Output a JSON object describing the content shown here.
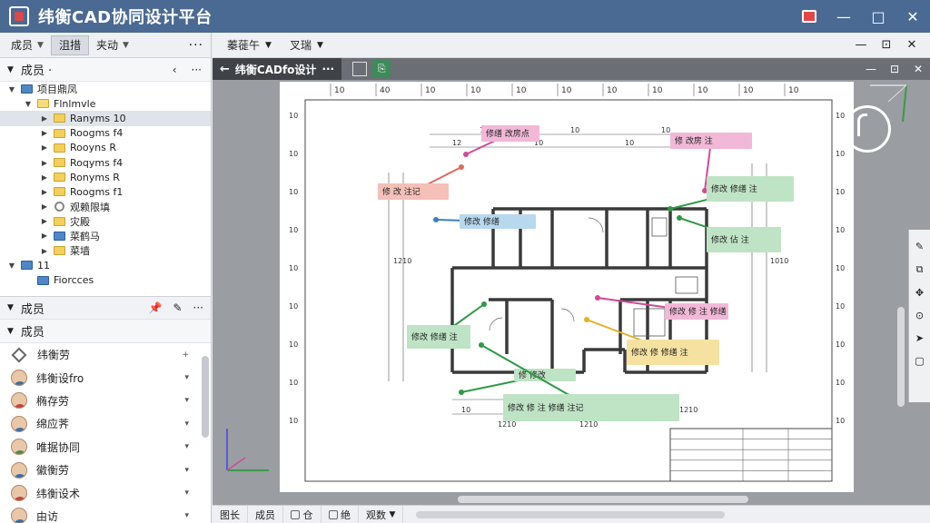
{
  "app": {
    "title": "纬衡CAD协同设计平台"
  },
  "window": {
    "minimize": "—",
    "maximize": "□",
    "close": "✕"
  },
  "left_toolbar": {
    "tabs": [
      {
        "label": "成员",
        "has_chevron": true
      },
      {
        "label": "沮措",
        "active": true
      },
      {
        "label": "夹动",
        "has_chevron": true
      }
    ],
    "more": "···"
  },
  "tree_header": {
    "label": "成员 ·",
    "collapse": "‹",
    "more": "···"
  },
  "tree": [
    {
      "label": "项目鼎凤",
      "level": 0,
      "expand": "▼",
      "icon": "blue"
    },
    {
      "label": "Flnlmvle",
      "level": 1,
      "expand": "▼",
      "icon": "open"
    },
    {
      "label": "Ranyms 10",
      "level": 2,
      "expand": "▶",
      "icon": "yellow",
      "selected": true
    },
    {
      "label": "Roogms f4",
      "level": 2,
      "expand": "▶",
      "icon": "yellow"
    },
    {
      "label": "Rooyns R",
      "level": 2,
      "expand": "▶",
      "icon": "yellow"
    },
    {
      "label": "Roqyms f4",
      "level": 2,
      "expand": "▶",
      "icon": "yellow"
    },
    {
      "label": "Ronyms R",
      "level": 2,
      "expand": "▶",
      "icon": "yellow"
    },
    {
      "label": "Roogms f1",
      "level": 2,
      "expand": "▶",
      "icon": "yellow"
    },
    {
      "label": "观赖限填",
      "level": 2,
      "expand": "▶",
      "icon": "gear"
    },
    {
      "label": "灾殿",
      "level": 2,
      "expand": "▶",
      "icon": "yellow"
    },
    {
      "label": "菜鹤马",
      "level": 2,
      "expand": "▶",
      "icon": "blue"
    },
    {
      "label": "菜墙",
      "level": 2,
      "expand": "▶",
      "icon": "yellow"
    },
    {
      "label": "11",
      "level": 0,
      "expand": "▼",
      "icon": "blue"
    },
    {
      "label": "Fiorcces",
      "level": 1,
      "expand": "",
      "icon": "blue"
    }
  ],
  "members_toolbar": {
    "label": "成员",
    "pin": "📌",
    "edit": "✎",
    "more": "···"
  },
  "members_header": {
    "label": "成员"
  },
  "members": [
    {
      "name": "纬衡劳",
      "type": "diamond",
      "action": "+"
    },
    {
      "name": "纬衡设fro",
      "type": "m",
      "action": "▾"
    },
    {
      "name": "椭存劳",
      "type": "f",
      "action": "▾"
    },
    {
      "name": "绵应荠",
      "type": "m",
      "action": "▾"
    },
    {
      "name": "唯据协同",
      "type": "g",
      "action": "▾"
    },
    {
      "name": "徽衡劳",
      "type": "m",
      "action": "▾"
    },
    {
      "name": "纬衡设术",
      "type": "f",
      "action": "▾"
    },
    {
      "name": "由访",
      "type": "m",
      "action": "▾"
    }
  ],
  "main_toolbar": {
    "menus": [
      {
        "label": "蓁蓰午",
        "has_chevron": true
      },
      {
        "label": "叉瑞",
        "has_chevron": true
      }
    ],
    "right": [
      "—",
      "⊡",
      "✕"
    ]
  },
  "doc_tab": {
    "label": "纬衡CADfo设计",
    "ellipsis": "···",
    "back": "←"
  },
  "doc_right": [
    "—",
    "⊡",
    "✕"
  ],
  "drawing": {
    "top_dims": [
      "10",
      "40",
      "10",
      "10",
      "10",
      "10",
      "10",
      "10",
      "10",
      "10",
      "10"
    ],
    "left_dims": [
      "10",
      "10",
      "10",
      "10",
      "10",
      "10",
      "10",
      "10",
      "10"
    ],
    "right_dims": [
      "10",
      "10",
      "10",
      "10",
      "10",
      "10",
      "10",
      "10",
      "10"
    ],
    "inner_dims": [
      "10",
      "10",
      "10",
      "12",
      "10",
      "10",
      "10",
      "10",
      "10",
      "1210",
      "1210",
      "1210",
      "1210",
      "1210",
      "1010"
    ],
    "annotations": [
      {
        "text": "修缮 改房点",
        "color": "#f2b8d8",
        "arrow": "#d04a9a"
      },
      {
        "text": "修 改房 注",
        "color": "#f2b8d8",
        "arrow": "#d04a9a"
      },
      {
        "text": "修 改 注记",
        "color": "#f4c0b8",
        "arrow": "#e06a5a"
      },
      {
        "text": "修改 修缮 注",
        "color": "#bfe3c5",
        "arrow": "#2f9a45"
      },
      {
        "text": "修改 佔 注",
        "color": "#bfe3c5",
        "arrow": "#2f9a45"
      },
      {
        "text": "修改 修缮",
        "color": "#b8d8ee",
        "arrow": "#3a7fc0"
      },
      {
        "text": "修改 修缮 注",
        "color": "#bfe3c5",
        "arrow": "#2f9a45"
      },
      {
        "text": "修改 修 注 修缮",
        "color": "#f2b8d8",
        "arrow": "#d04a9a"
      },
      {
        "text": "修改 修 修缮 注",
        "color": "#f6e2a0",
        "arrow": "#e2b02a"
      },
      {
        "text": "修 修改",
        "color": "#bfe3c5",
        "arrow": "#2f9a45"
      },
      {
        "text": "修改 修 注 修缮 注记",
        "color": "#bfe3c5",
        "arrow": "#2f9a45"
      }
    ]
  },
  "bottombar": {
    "items": [
      "图长",
      "成员",
      "仓",
      "绝",
      "观数"
    ]
  }
}
